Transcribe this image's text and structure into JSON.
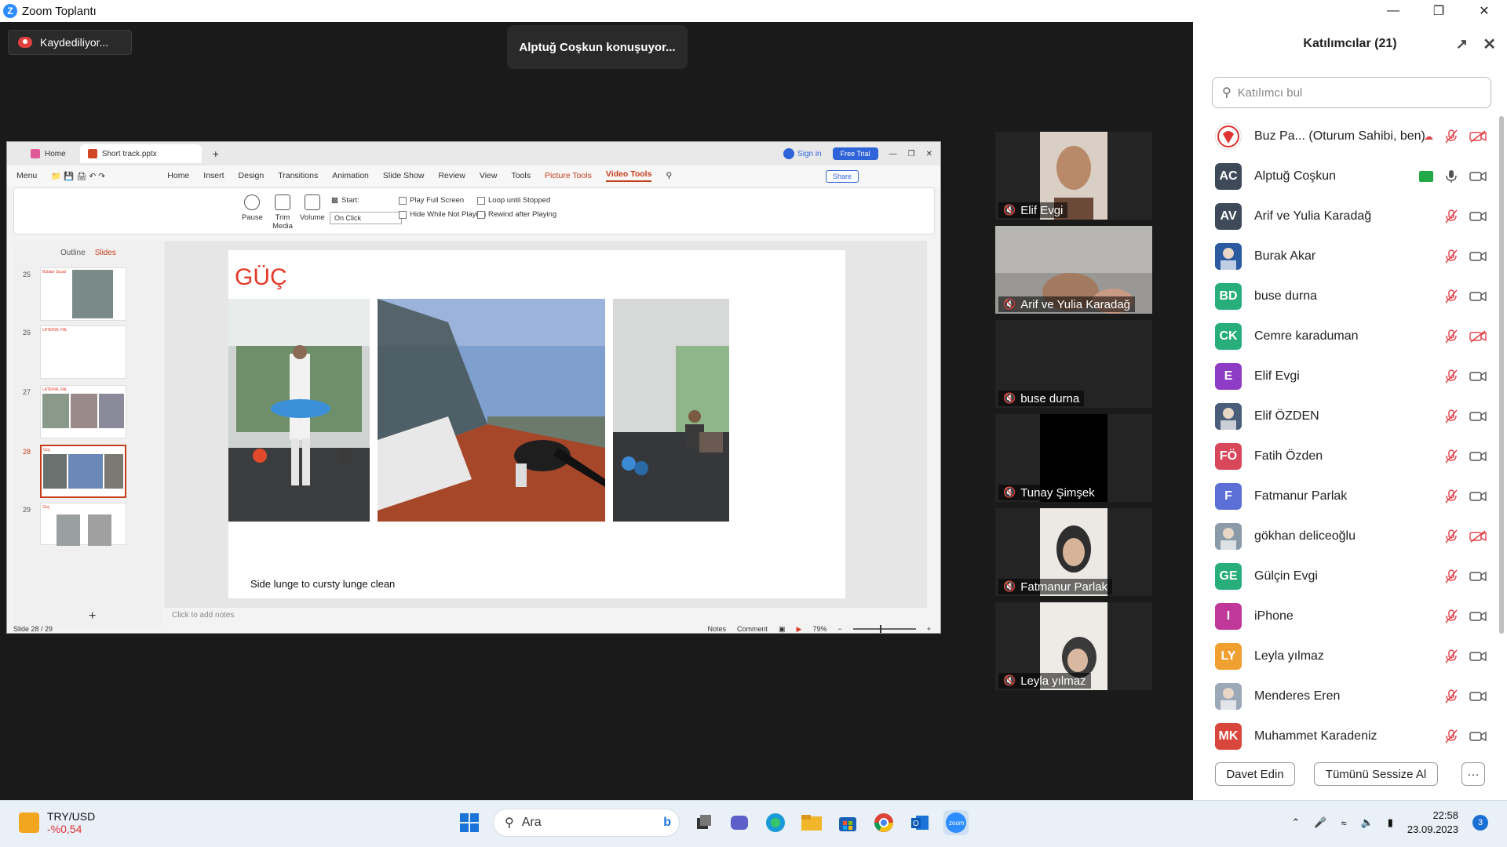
{
  "window": {
    "title": "Zoom Toplantı"
  },
  "meeting": {
    "recording_label": "Kaydediliyor...",
    "speaking_label": "Alptuğ Coşkun konuşuyor..."
  },
  "ppt": {
    "tabs": {
      "home": "Home",
      "file": "Short track.pptx",
      "signin": "Sign in",
      "free_trial": "Free Trial",
      "share": "Share"
    },
    "menu": [
      "Menu",
      "Home",
      "Insert",
      "Design",
      "Transitions",
      "Animation",
      "Slide Show",
      "Review",
      "View",
      "Tools",
      "Picture Tools",
      "Video Tools"
    ],
    "ribbon": {
      "pause": "Pause",
      "trim": "Trim Media",
      "volume": "Volume",
      "start": "Start:",
      "start_value": "On Click",
      "play_full": "Play Full Screen",
      "hide_not_playing": "Hide While Not Playing",
      "loop": "Loop until Stopped",
      "rewind": "Rewind after Playing"
    },
    "panel": {
      "outline": "Outline",
      "slides": "Slides"
    },
    "thumbs": [
      {
        "num": "25",
        "title": "Bulalar Squat"
      },
      {
        "num": "26",
        "title": "LATERAL FAL"
      },
      {
        "num": "27",
        "title": "LATERAL FAL"
      },
      {
        "num": "28",
        "title": "Güç"
      },
      {
        "num": "29",
        "title": "Güç"
      }
    ],
    "slide": {
      "title": "GÜÇ",
      "caption": "Side lunge to cursty lunge clean"
    },
    "notes_placeholder": "Click to add notes",
    "status": {
      "slide_count": "Slide 28 / 29",
      "notes": "Notes",
      "comment": "Comment",
      "zoom": "79%"
    }
  },
  "video_tiles": [
    {
      "name": "Elif Evgi",
      "muted": true,
      "has_video": true
    },
    {
      "name": "Arif ve Yulia Karadağ",
      "muted": true,
      "has_video": true
    },
    {
      "name": "buse durna",
      "muted": true,
      "has_video": false
    },
    {
      "name": "Tunay Şimşek",
      "muted": true,
      "has_video": true
    },
    {
      "name": "Fatmanur Parlak",
      "muted": true,
      "has_video": true
    },
    {
      "name": "Leyla yılmaz",
      "muted": true,
      "has_video": true
    }
  ],
  "participants_panel": {
    "title": "Katılımcılar (21)",
    "search_placeholder": "Katılımcı bul",
    "participants": [
      {
        "initials": "",
        "name": "Buz Pa... (Oturum Sahibi, ben)",
        "color": "#ffffff",
        "mic": "muted",
        "cam": "off",
        "avatar": "logo"
      },
      {
        "initials": "AC",
        "name": "Alptuğ Coşkun",
        "color": "#3e4a59",
        "mic": "on",
        "cam": "on",
        "share": true
      },
      {
        "initials": "AV",
        "name": "Arif ve Yulia Karadağ",
        "color": "#3e4a59",
        "mic": "muted",
        "cam": "on"
      },
      {
        "initials": "",
        "name": "Burak Akar",
        "color": "#2c5aa0",
        "mic": "muted",
        "cam": "on",
        "avatar": "photo"
      },
      {
        "initials": "BD",
        "name": "buse durna",
        "color": "#27ae7a",
        "mic": "muted",
        "cam": "on"
      },
      {
        "initials": "CK",
        "name": "Cemre karaduman",
        "color": "#27ae7a",
        "mic": "muted",
        "cam": "off"
      },
      {
        "initials": "E",
        "name": "Elif Evgi",
        "color": "#8e3bc6",
        "mic": "muted",
        "cam": "on"
      },
      {
        "initials": "",
        "name": "Elif ÖZDEN",
        "color": "#4a5d7a",
        "mic": "muted",
        "cam": "on",
        "avatar": "photo"
      },
      {
        "initials": "FÖ",
        "name": "Fatih Özden",
        "color": "#d9475b",
        "mic": "muted",
        "cam": "on"
      },
      {
        "initials": "F",
        "name": "Fatmanur Parlak",
        "color": "#5b6fd6",
        "mic": "muted",
        "cam": "on"
      },
      {
        "initials": "",
        "name": "gökhan deliceoğlu",
        "color": "#8a9aa8",
        "mic": "muted",
        "cam": "off",
        "avatar": "photo"
      },
      {
        "initials": "GE",
        "name": "Gülçin Evgi",
        "color": "#27ae7a",
        "mic": "muted",
        "cam": "on"
      },
      {
        "initials": "I",
        "name": "iPhone",
        "color": "#c0399a",
        "mic": "muted",
        "cam": "on"
      },
      {
        "initials": "LY",
        "name": "Leyla yılmaz",
        "color": "#f0a030",
        "mic": "muted",
        "cam": "on"
      },
      {
        "initials": "",
        "name": "Menderes Eren",
        "color": "#9aa8b8",
        "mic": "muted",
        "cam": "on",
        "avatar": "photo"
      },
      {
        "initials": "MK",
        "name": "Muhammet Karadeniz",
        "color": "#d9473c",
        "mic": "muted",
        "cam": "on"
      }
    ],
    "invite_label": "Davet Edin",
    "mute_all_label": "Tümünü Sessize Al",
    "more_label": "···"
  },
  "taskbar": {
    "widget_title": "TRY/USD",
    "widget_value": "-%0,54",
    "search_label": "Ara",
    "time": "22:58",
    "date": "23.09.2023",
    "notifications": "3"
  }
}
